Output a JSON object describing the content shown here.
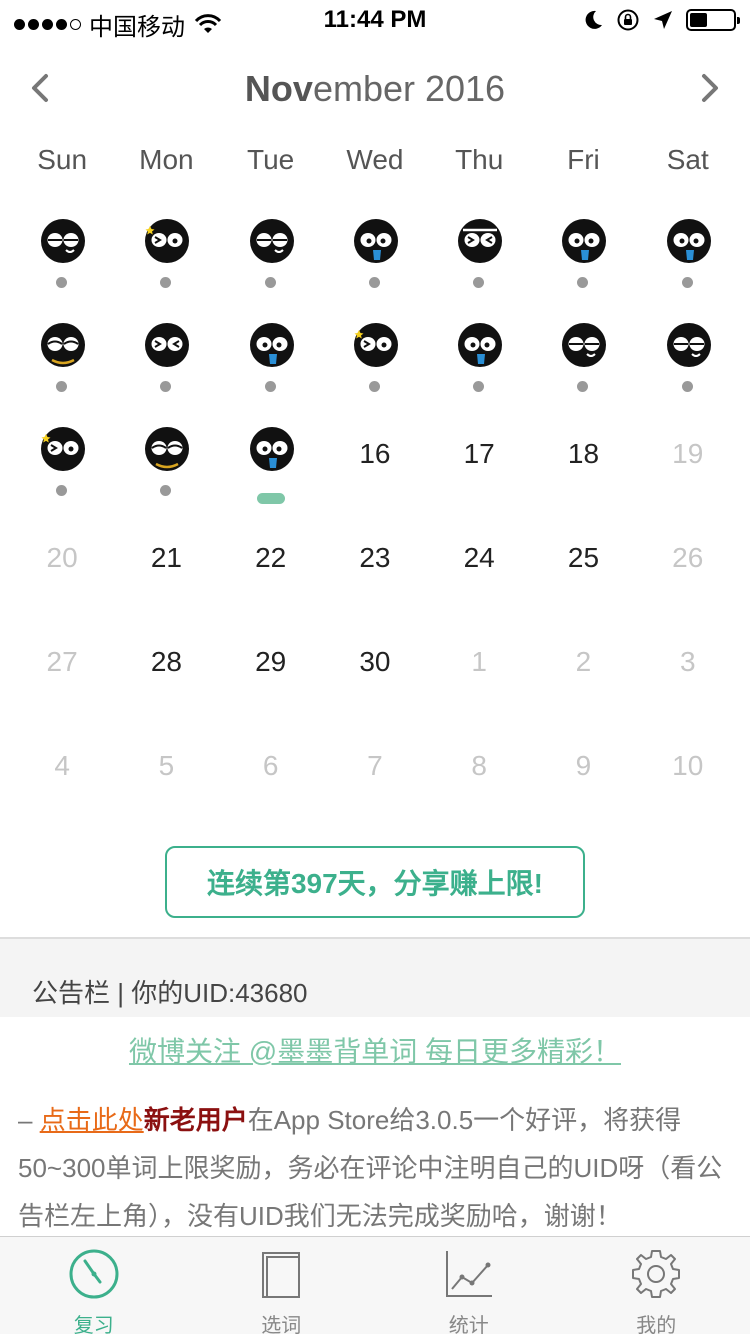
{
  "status_bar": {
    "carrier": "中国移动",
    "time": "11:44 PM"
  },
  "calendar": {
    "month_bold": "Nov",
    "month_rest": "ember 2016",
    "weekdays": [
      "Sun",
      "Mon",
      "Tue",
      "Wed",
      "Thu",
      "Fri",
      "Sat"
    ],
    "weeks": [
      [
        {
          "face": "smirk"
        },
        {
          "face": "wink-star"
        },
        {
          "face": "smirk"
        },
        {
          "face": "tongue"
        },
        {
          "face": "squint-bandana"
        },
        {
          "face": "tongue"
        },
        {
          "face": "tongue"
        }
      ],
      [
        {
          "face": "sleepy-chain"
        },
        {
          "face": "squint"
        },
        {
          "face": "tongue"
        },
        {
          "face": "wink-star"
        },
        {
          "face": "tongue"
        },
        {
          "face": "smirk"
        },
        {
          "face": "smirk"
        }
      ],
      [
        {
          "face": "wink-star"
        },
        {
          "face": "sleepy-chain"
        },
        {
          "face": "tongue",
          "today": true
        },
        {
          "day": "16"
        },
        {
          "day": "17"
        },
        {
          "day": "18"
        },
        {
          "day": "19",
          "muted": true
        }
      ],
      [
        {
          "day": "20",
          "muted": true
        },
        {
          "day": "21"
        },
        {
          "day": "22"
        },
        {
          "day": "23"
        },
        {
          "day": "24"
        },
        {
          "day": "25"
        },
        {
          "day": "26",
          "muted": true
        }
      ],
      [
        {
          "day": "27",
          "muted": true
        },
        {
          "day": "28"
        },
        {
          "day": "29"
        },
        {
          "day": "30"
        },
        {
          "day": "1",
          "muted": true
        },
        {
          "day": "2",
          "muted": true
        },
        {
          "day": "3",
          "muted": true
        }
      ],
      [
        {
          "day": "4",
          "muted": true
        },
        {
          "day": "5",
          "muted": true
        },
        {
          "day": "6",
          "muted": true
        },
        {
          "day": "7",
          "muted": true
        },
        {
          "day": "8",
          "muted": true
        },
        {
          "day": "9",
          "muted": true
        },
        {
          "day": "10",
          "muted": true
        }
      ]
    ]
  },
  "streak_button": "连续第397天，分享赚上限!",
  "bulletin": {
    "header": "公告栏 | 你的UID:43680",
    "weibo_link": "微博关注 @墨墨背单词 每日更多精彩！",
    "notice_prefix": "– ",
    "notice_link": "点击此处",
    "notice_bold": "新老用户",
    "notice_text": "在App Store给3.0.5一个好评，将获得50~300单词上限奖励，务必在评论中注明自己的UID呀（看公告栏左上角），没有UID我们无法完成奖励哈，谢谢！"
  },
  "tabs": [
    {
      "label": "复习",
      "icon": "timer-icon",
      "active": true
    },
    {
      "label": "选词",
      "icon": "book-icon",
      "active": false
    },
    {
      "label": "统计",
      "icon": "chart-icon",
      "active": false
    },
    {
      "label": "我的",
      "icon": "gear-icon",
      "active": false
    }
  ],
  "colors": {
    "accent": "#3cb08c",
    "accent_light": "#7fc7a8",
    "link_orange": "#e86a18",
    "bold_red": "#8b1010"
  }
}
